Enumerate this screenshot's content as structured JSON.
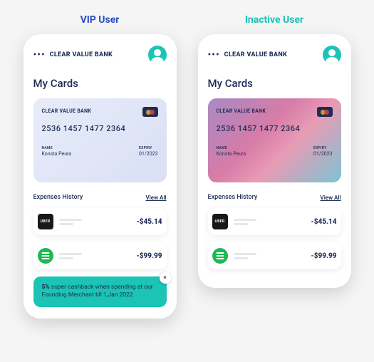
{
  "labels": {
    "vip": "VIP User",
    "inactive": "Inactive User"
  },
  "header": {
    "bank_name": "CLEAR VALUE BANK"
  },
  "section_title": "My Cards",
  "card": {
    "bank": "CLEAR VALUE BANK",
    "number": "2536 1457 1477 2364",
    "name_label": "NAME",
    "name_value": "Konsta Peura",
    "expiry_label": "EXPIRY",
    "expiry_value": "01/2023"
  },
  "expenses": {
    "title": "Expenses History",
    "view_all": "View All",
    "items": [
      {
        "merchant": "UBER",
        "amount": "-$45.14"
      },
      {
        "merchant": "Spotify",
        "amount": "-$99.99"
      }
    ]
  },
  "promo": {
    "bold": "5%",
    "text": " super cashback when spending at our Founding Merchant till 1,Jan 2022",
    "close": "×"
  }
}
